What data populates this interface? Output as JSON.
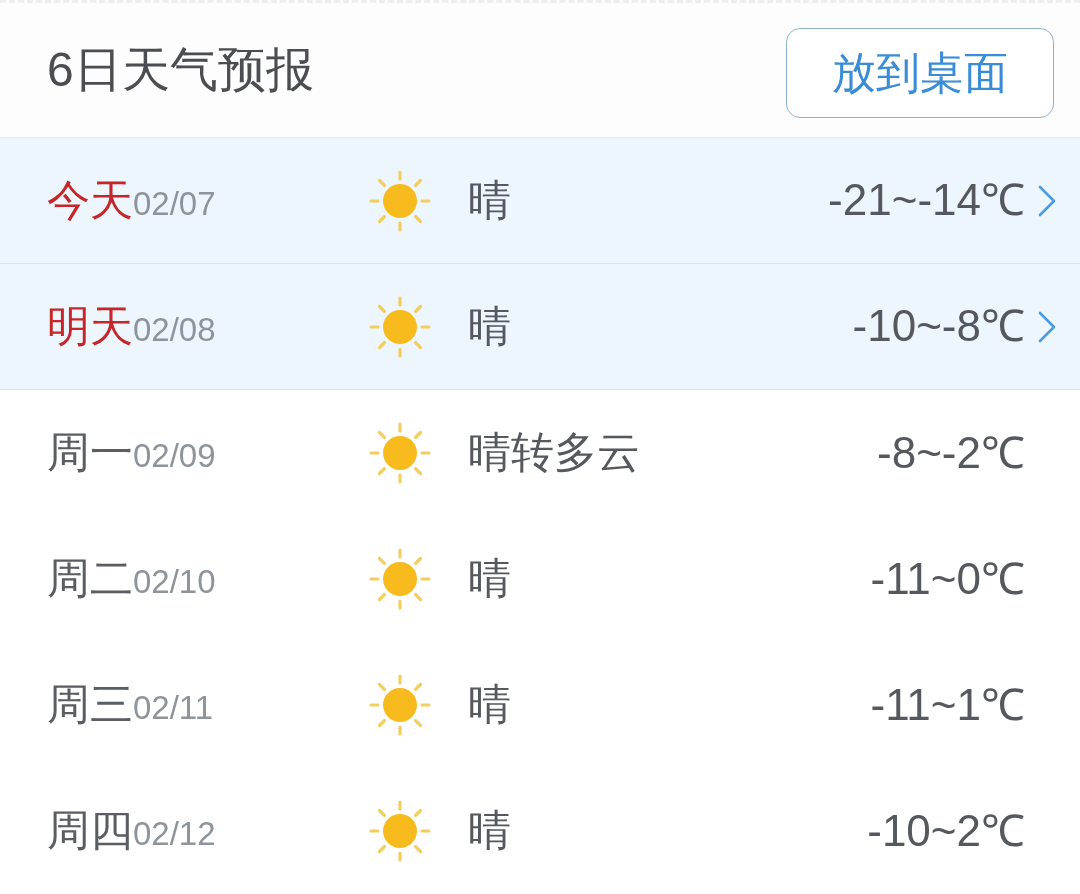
{
  "header": {
    "title": "6日天气预报",
    "button": "放到桌面"
  },
  "forecast": [
    {
      "day": "今天",
      "date": "02/07",
      "condition": "晴",
      "temperature": "-21~-14℃",
      "highlighted": true
    },
    {
      "day": "明天",
      "date": "02/08",
      "condition": "晴",
      "temperature": "-10~-8℃",
      "highlighted": true
    },
    {
      "day": "周一",
      "date": "02/09",
      "condition": "晴转多云",
      "temperature": "-8~-2℃",
      "highlighted": false
    },
    {
      "day": "周二",
      "date": "02/10",
      "condition": "晴",
      "temperature": "-11~0℃",
      "highlighted": false
    },
    {
      "day": "周三",
      "date": "02/11",
      "condition": "晴",
      "temperature": "-11~1℃",
      "highlighted": false
    },
    {
      "day": "周四",
      "date": "02/12",
      "condition": "晴",
      "temperature": "-10~2℃",
      "highlighted": false
    }
  ]
}
